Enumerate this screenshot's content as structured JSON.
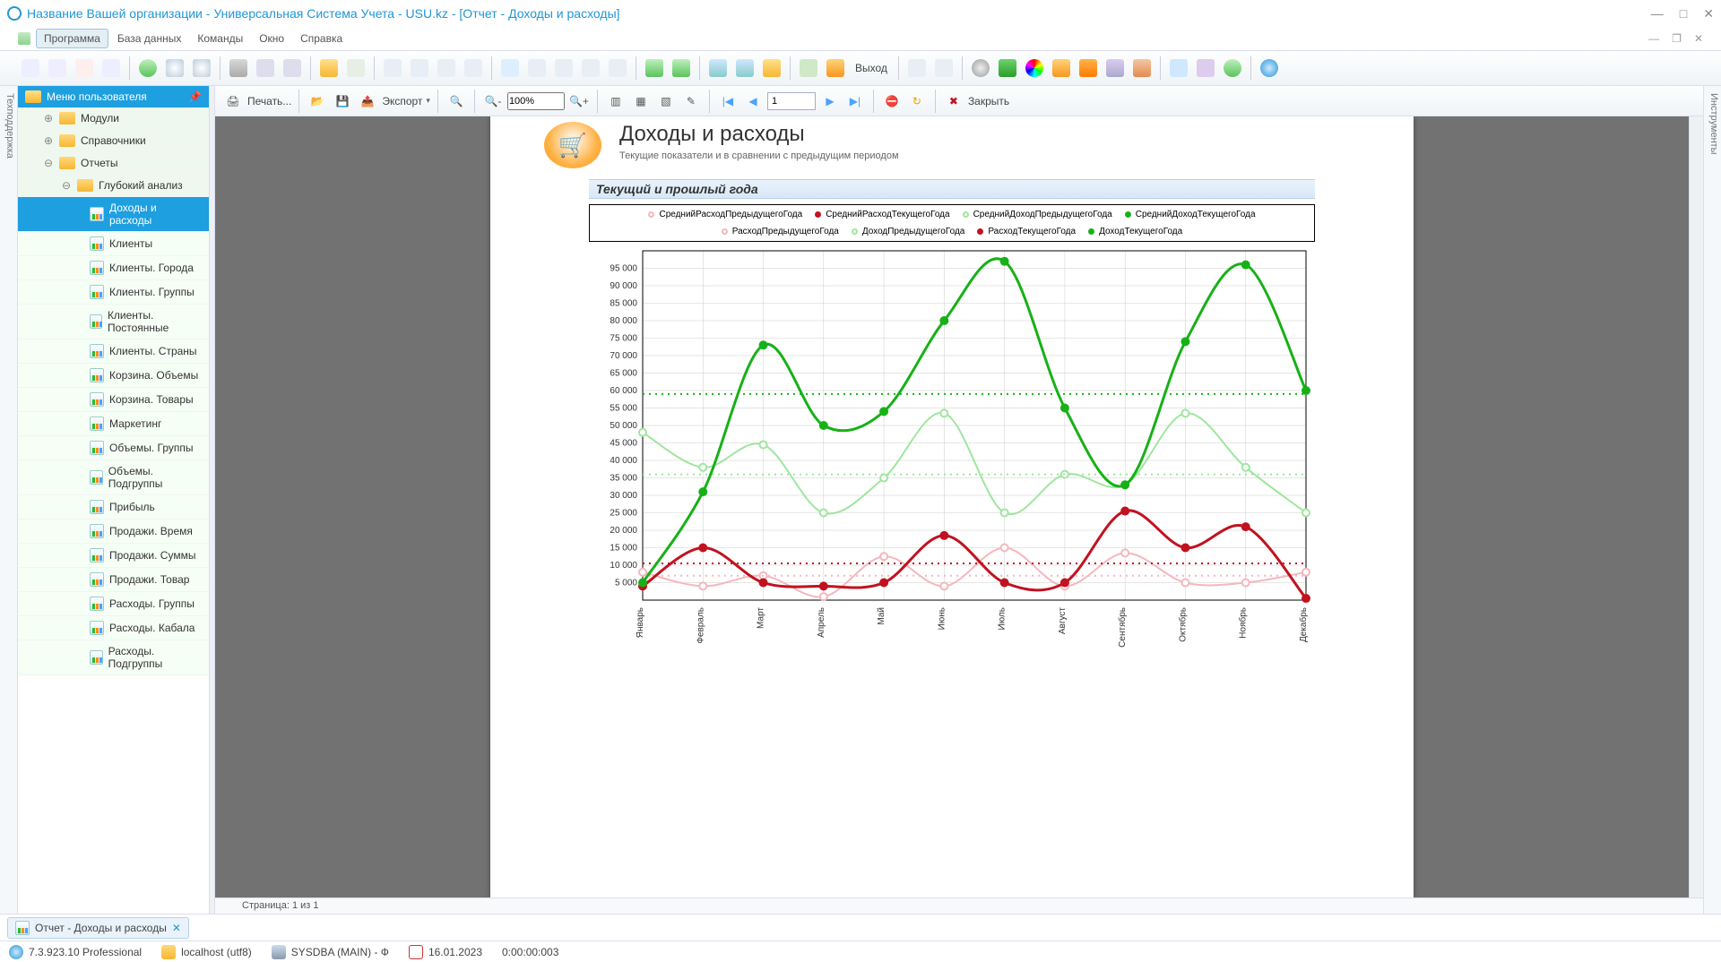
{
  "window": {
    "org": "Название Вашей организации",
    "app": "Универсальная Система Учета - USU.kz",
    "doc": "[Отчет - Доходы и расходы]"
  },
  "menu": {
    "program": "Программа",
    "database": "База данных",
    "commands": "Команды",
    "window_m": "Окно",
    "help": "Справка"
  },
  "main_toolbar": {
    "exit": "Выход"
  },
  "leftdock": "Техподдержка",
  "rightdock": "Инструменты",
  "sidebar": {
    "title": "Меню пользователя",
    "modules": "Модули",
    "refs": "Справочники",
    "reports": "Отчеты",
    "deep": "Глубокий анализ",
    "items": [
      "Доходы и расходы",
      "Клиенты",
      "Клиенты. Города",
      "Клиенты. Группы",
      "Клиенты. Постоянные",
      "Клиенты. Страны",
      "Корзина. Объемы",
      "Корзина. Товары",
      "Маркетинг",
      "Объемы. Группы",
      "Объемы. Подгруппы",
      "Прибыль",
      "Продажи. Время",
      "Продажи. Суммы",
      "Продажи. Товар",
      "Расходы. Группы",
      "Расходы. Кабала",
      "Расходы. Подгруппы"
    ]
  },
  "report_toolbar": {
    "print": "Печать...",
    "export": "Экспорт",
    "zoom": "100%",
    "page": "1",
    "close": "Закрыть"
  },
  "report": {
    "title": "Доходы и расходы",
    "subtitle": "Текущие показатели и в сравнении с предыдущим периодом",
    "section": "Текущий и прошлый года",
    "status": "Страница: 1 из 1"
  },
  "legend": {
    "s1": "СреднийРасходПредыдущегоГода",
    "s2": "СреднийРасходТекущегоГода",
    "s3": "СреднийДоходПредыдущегоГода",
    "s4": "СреднийДоходТекущегоГода",
    "s5": "РасходПредыдущегоГода",
    "s6": "ДоходПредыдущегоГода",
    "s7": "РасходТекущегоГода",
    "s8": "ДоходТекущегоГода"
  },
  "tab": {
    "label": "Отчет - Доходы и расходы"
  },
  "status": {
    "ver": "7.3.923.10 Professional",
    "host": "localhost (utf8)",
    "user": "SYSDBA (MAIN) - Ф",
    "date": "16.01.2023",
    "time": "0:00:00:003"
  },
  "chart_data": {
    "type": "line",
    "title": "Доходы и расходы — Текущий и прошлый года",
    "xlabel": "",
    "ylabel": "",
    "ylim": [
      0,
      100000
    ],
    "yticks": [
      5000,
      10000,
      15000,
      20000,
      25000,
      30000,
      35000,
      40000,
      45000,
      50000,
      55000,
      60000,
      65000,
      70000,
      75000,
      80000,
      85000,
      90000,
      95000
    ],
    "ytick_labels": [
      "5 000",
      "10 000",
      "15 000",
      "20 000",
      "25 000",
      "30 000",
      "35 000",
      "40 000",
      "45 000",
      "50 000",
      "55 000",
      "60 000",
      "65 000",
      "70 000",
      "75 000",
      "80 000",
      "85 000",
      "90 000",
      "95 000"
    ],
    "categories": [
      "Январь",
      "Февраль",
      "Март",
      "Апрель",
      "Май",
      "Июнь",
      "Июль",
      "Август",
      "Сентябрь",
      "Октябрь",
      "Ноябрь",
      "Декабрь"
    ],
    "series": [
      {
        "name": "ДоходТекущегоГода",
        "color": "#17b117",
        "values": [
          5000,
          31000,
          73000,
          50000,
          54000,
          80000,
          97000,
          55000,
          33000,
          74000,
          96000,
          60000
        ]
      },
      {
        "name": "РасходТекущегоГода",
        "color": "#c1121f",
        "values": [
          4000,
          15000,
          5000,
          4000,
          5000,
          18500,
          5000,
          5000,
          25500,
          15000,
          21000,
          500
        ]
      },
      {
        "name": "ДоходПредыдущегоГода",
        "color": "#9fe69f",
        "values": [
          48000,
          38000,
          44500,
          25000,
          35000,
          53500,
          25000,
          36000,
          33000,
          53500,
          38000,
          25000
        ]
      },
      {
        "name": "РасходПредыдущегоГода",
        "color": "#f4b7bd",
        "values": [
          8000,
          4000,
          7000,
          1000,
          12500,
          4000,
          15000,
          4000,
          13500,
          5000,
          5000,
          8000
        ]
      },
      {
        "name": "СреднийДоходТекущегоГода",
        "color": "#17b117",
        "style": "dotted",
        "values": [
          59000,
          59000,
          59000,
          59000,
          59000,
          59000,
          59000,
          59000,
          59000,
          59000,
          59000,
          59000
        ]
      },
      {
        "name": "СреднийДоходПредыдущегоГода",
        "color": "#9fe69f",
        "style": "dotted",
        "values": [
          36000,
          36000,
          36000,
          36000,
          36000,
          36000,
          36000,
          36000,
          36000,
          36000,
          36000,
          36000
        ]
      },
      {
        "name": "СреднийРасходТекущегоГода",
        "color": "#c1121f",
        "style": "dotted",
        "values": [
          10500,
          10500,
          10500,
          10500,
          10500,
          10500,
          10500,
          10500,
          10500,
          10500,
          10500,
          10500
        ]
      },
      {
        "name": "СреднийРасходПредыдущегоГода",
        "color": "#f4b7bd",
        "style": "dotted",
        "values": [
          7000,
          7000,
          7000,
          7000,
          7000,
          7000,
          7000,
          7000,
          7000,
          7000,
          7000,
          7000
        ]
      }
    ]
  }
}
